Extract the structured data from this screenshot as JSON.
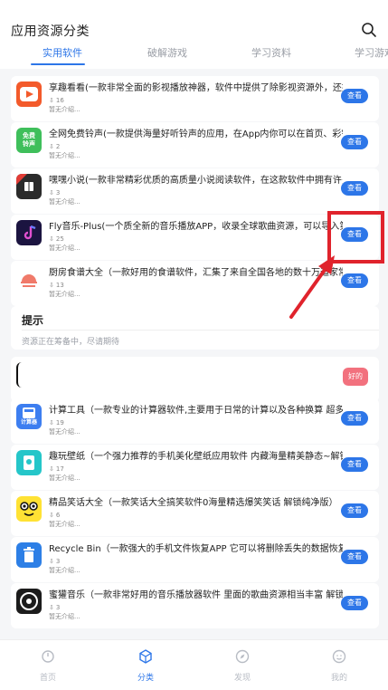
{
  "header": {
    "title": "应用资源分类",
    "tabs": [
      {
        "label": "实用软件",
        "active": true
      },
      {
        "label": "破解游戏",
        "active": false
      },
      {
        "label": "学习资料",
        "active": false
      },
      {
        "label": "学习游戏",
        "active": false
      }
    ]
  },
  "apps": [
    {
      "name": "享趣看看(一款非常全面的影视播放神器，软件中提供了除影视资源外，还提",
      "downloads": "16",
      "desc": "暂无介绍...",
      "button": "查看",
      "icon": "play-icon",
      "icon_color": "#f35a2b"
    },
    {
      "name": "全网免费铃声(一款提供海量好听铃声的应用，在App内你可以在首页、彩铃",
      "downloads": "2",
      "desc": "暂无介绍...",
      "button": "查看",
      "icon": "ringtone-icon",
      "icon_color": "#3fbf5b",
      "icon_text": "免费铃声"
    },
    {
      "name": "嘿嘿小说(一款非常精彩优质的高质量小说阅读软件，在这款软件中拥有许多",
      "downloads": "3",
      "desc": "暂无介绍...",
      "button": "查看",
      "icon": "book-icon",
      "icon_color": "#e23c36"
    },
    {
      "name": "Fly音乐-Plus(一个质全新的音乐播放APP，收录全球歌曲资源，可以导入第",
      "downloads": "25",
      "desc": "暂无介绍...",
      "button": "查看",
      "icon": "music-note-icon",
      "icon_color": "#1b1440"
    },
    {
      "name": "厨房食谱大全（一款好用的食谱软件，汇集了来自全国各地的数十万道家常",
      "downloads": "13",
      "desc": "暂无介绍...",
      "button": "查看",
      "icon": "cloche-icon",
      "icon_color": "#ffffff"
    },
    {
      "name": "",
      "downloads": "",
      "desc": "",
      "button": "好的",
      "icon": "",
      "icon_color": "#ffffff"
    },
    {
      "name": "计算工具（一款专业的计算器软件,主要用于日常的计算以及各种换算 超多",
      "downloads": "19",
      "desc": "暂无介绍...",
      "button": "查看",
      "icon": "calculator-icon",
      "icon_color": "#3d7ef0",
      "icon_text": "计算器"
    },
    {
      "name": "趣玩壁纸（一个强力推荐的手机美化壁纸应用软件 内藏海量精美静态~解锁",
      "downloads": "17",
      "desc": "暂无介绍...",
      "button": "查看",
      "icon": "wallpaper-icon",
      "icon_color": "#25c6c9"
    },
    {
      "name": "精品笑话大全（一款笑话大全搞笑软件0海量精选爆笑笑话 解锁纯净版）",
      "downloads": "6",
      "desc": "暂无介绍...",
      "button": "查看",
      "icon": "emoji-face-icon",
      "icon_color": "#ffe234"
    },
    {
      "name": "Recycle Bin（一款强大的手机文件恢复APP 它可以将删除丢失的数据恢复",
      "downloads": "3",
      "desc": "暂无介绍...",
      "button": "查看",
      "icon": "recycle-bin-icon",
      "icon_color": "#2d7fe6"
    },
    {
      "name": "蜜獾音乐（一款非常好用的音乐播放器软件 里面的歌曲资源相当丰富 解锁",
      "downloads": "3",
      "desc": "暂无介绍...",
      "button": "查看",
      "icon": "music-disc-icon",
      "icon_color": "#1c1c1c"
    }
  ],
  "prompt": {
    "title": "提示",
    "message": "资源正在筹备中，尽请期待"
  },
  "nav": [
    {
      "label": "首页",
      "icon": "home-icon",
      "active": false
    },
    {
      "label": "分类",
      "icon": "category-cube-icon",
      "active": true
    },
    {
      "label": "发现",
      "icon": "compass-icon",
      "active": false
    },
    {
      "label": "我的",
      "icon": "profile-icon",
      "active": false
    }
  ],
  "colors": {
    "accent": "#2d76e8",
    "annotation": "#e0232c",
    "confirm": "#f2717e"
  }
}
